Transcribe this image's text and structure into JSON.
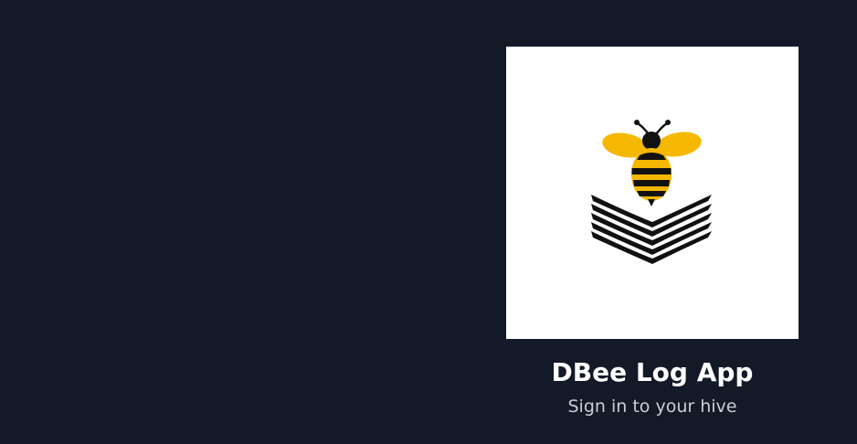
{
  "brand": {
    "logo_icon": "bee-book-logo-icon",
    "title": "DBee Log App",
    "subtitle": "Sign in to your hive"
  },
  "colors": {
    "background": "#131927",
    "logo_card": "#ffffff",
    "bee_yellow": "#f5b800",
    "bee_black": "#111111",
    "title_text": "#ffffff",
    "subtitle_text": "#c9ced8"
  }
}
